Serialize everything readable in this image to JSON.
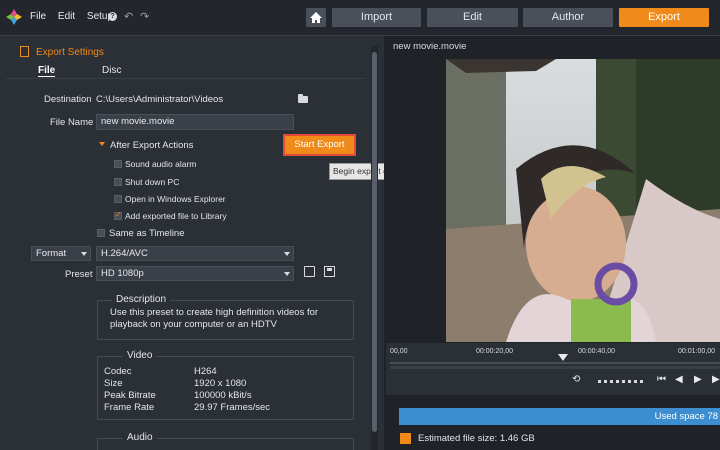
{
  "menu": {
    "file": "File",
    "edit": "Edit",
    "setup": "Setup",
    "help": "?"
  },
  "nav": {
    "import": "Import",
    "edit": "Edit",
    "author": "Author",
    "export": "Export"
  },
  "panel": {
    "title": "Export Settings",
    "tab_file": "File",
    "tab_disc": "Disc"
  },
  "destination": {
    "label": "Destination",
    "value": "C:\\Users\\Administrator\\Videos"
  },
  "filename": {
    "label": "File Name",
    "value": "new movie.movie"
  },
  "after_export": {
    "title": "After Export Actions",
    "options": [
      {
        "label": "Sound audio alarm",
        "checked": false
      },
      {
        "label": "Shut down PC",
        "checked": false
      },
      {
        "label": "Open in Windows Explorer",
        "checked": false
      },
      {
        "label": "Add exported file to Library",
        "checked": true
      }
    ]
  },
  "start_export": "Start Export",
  "tooltip": "Begin export of your current file and settings.",
  "same_as_timeline": "Same as Timeline",
  "format": {
    "label": "Format",
    "value": "H.264/AVC"
  },
  "preset": {
    "label": "Preset",
    "value": "HD 1080p"
  },
  "description": {
    "title": "Description",
    "text": "Use this preset to create high definition videos for playback on your computer or an HDTV"
  },
  "video": {
    "title": "Video",
    "rows": [
      {
        "key": "Codec",
        "value": "H264"
      },
      {
        "key": "Size",
        "value": "1920 x 1080"
      },
      {
        "key": "Peak Bitrate",
        "value": "100000 kBit/s"
      },
      {
        "key": "Frame Rate",
        "value": "29.97 Frames/sec"
      }
    ]
  },
  "audio": {
    "title": "Audio"
  },
  "preview": {
    "title": "new movie.movie",
    "timecodes": [
      "00,00",
      "00:00:20,00",
      "00:00:40,00",
      "00:01:00,00"
    ]
  },
  "used_space": "Used space 78",
  "estimated_size": "Estimated file size: 1.46 GB",
  "colors": {
    "accent": "#f08a19",
    "space_bar": "#3d8ed0"
  },
  "icons": [
    "logo-icon",
    "help-icon",
    "undo-icon",
    "redo-icon",
    "home-icon",
    "folder-icon",
    "edit-icon",
    "save-icon",
    "loop-icon",
    "jog-icon",
    "skip-start-icon",
    "step-back-icon",
    "play-icon"
  ]
}
